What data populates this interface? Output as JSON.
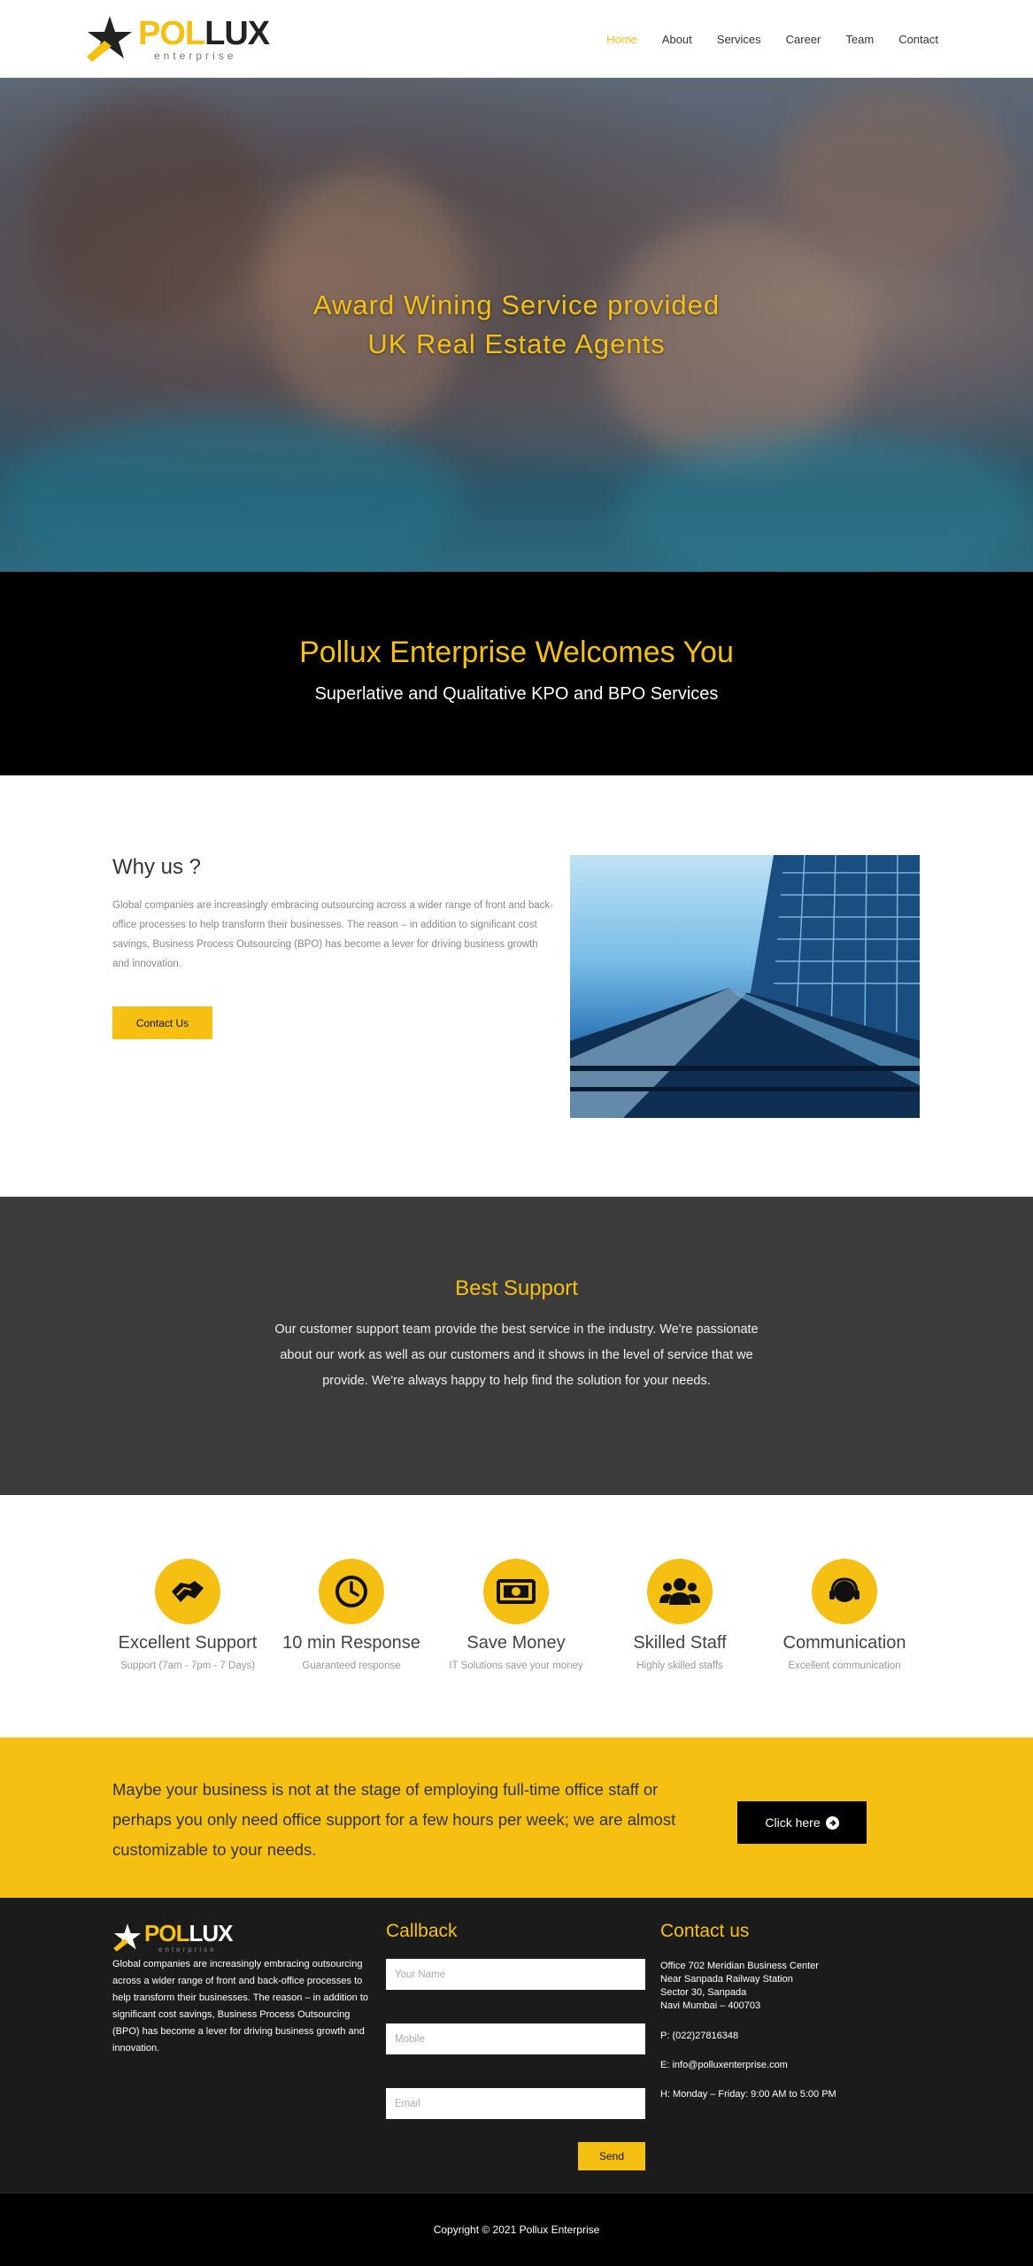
{
  "brand": {
    "pol": "POL",
    "lux": "LUX",
    "sub": "enterprise"
  },
  "nav": {
    "items": [
      {
        "label": "Home"
      },
      {
        "label": "About"
      },
      {
        "label": "Services"
      },
      {
        "label": "Career"
      },
      {
        "label": "Team"
      },
      {
        "label": "Contact"
      }
    ],
    "active": "Home"
  },
  "hero": {
    "line1": "Award Wining Service provided",
    "line2": "UK Real Estate Agents"
  },
  "welcome": {
    "title": "Pollux Enterprise Welcomes You",
    "subtitle": "Superlative and Qualitative KPO and BPO Services"
  },
  "why": {
    "title": "Why us ?",
    "description": "Global companies are increasingly embracing outsourcing across a wider range of front and back-office processes to help transform their businesses. The reason – in addition to significant cost savings, Business Process Outsourcing (BPO) has become a lever for driving business growth and innovation.",
    "button": "Contact Us"
  },
  "best": {
    "title": "Best Support",
    "text": "Our customer support team provide the best service in the industry. We're passionate about our work as well as our customers and it shows in the level of service that we provide. We're always happy to help find the solution for your needs."
  },
  "features": [
    {
      "icon": "handshake-icon",
      "title": "Excellent Support",
      "caption": "Support (7am - 7pm - 7 Days)"
    },
    {
      "icon": "clock-icon",
      "title": "10 min Response",
      "caption": "Guaranteed response"
    },
    {
      "icon": "money-icon",
      "title": "Save Money",
      "caption": "IT Solutions save your money"
    },
    {
      "icon": "users-icon",
      "title": "Skilled Staff",
      "caption": "Highly skilled staffs"
    },
    {
      "icon": "headset-icon",
      "title": "Communication",
      "caption": "Excellent communication"
    }
  ],
  "cta": {
    "text": "Maybe your business is not at the stage of employing full-time office staff or perhaps you only need office support for a few hours per week; we are almost customizable to your needs.",
    "button": "Click here"
  },
  "footer": {
    "about": "Global companies are increasingly embracing outsourcing across a wider range of front and back-office processes to help transform their businesses. The reason – in addition to significant cost savings, Business Process Outsourcing (BPO) has become a lever for driving business growth and innovation.",
    "callback": {
      "title": "Callback",
      "name_placeholder": "Your Name",
      "mobile_placeholder": "Mobile",
      "email_placeholder": "Email",
      "send": "Send"
    },
    "contact": {
      "title": "Contact us",
      "address1": "Office 702 Meridian Business Center",
      "address2": "Near Sanpada Railway Station",
      "address3": "Sector 30, Sanpada",
      "address4": "Navi Mumbai – 400703",
      "phone": "P: (022)27816348",
      "email": "E: info@polluxenterprise.com",
      "hours": "H: Monday – Friday: 9:00 AM to 5:00 PM"
    },
    "copyright": "Copyright © 2021 Pollux Enterprise"
  },
  "colors": {
    "accent": "#f5c012",
    "dark": "#1b1b1b",
    "section_gray": "#3b3b3b"
  }
}
